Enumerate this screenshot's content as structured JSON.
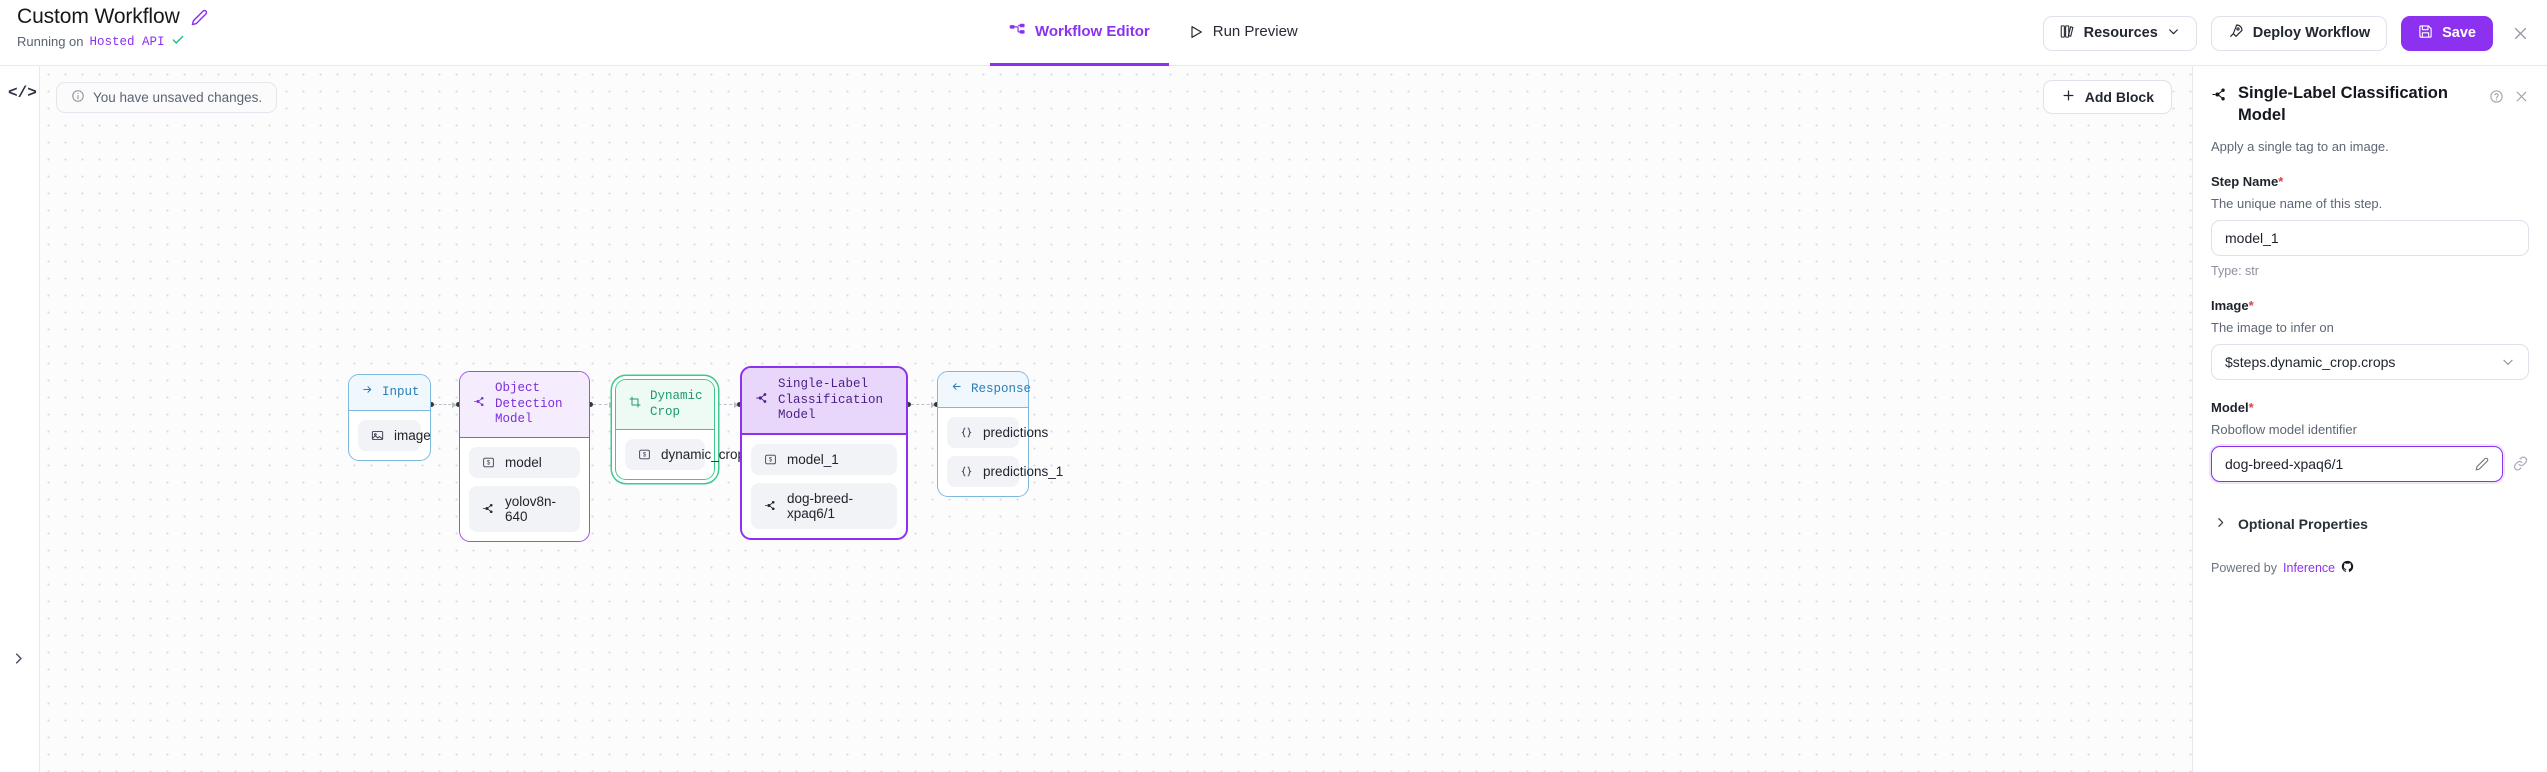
{
  "header": {
    "workflow_title": "Custom Workflow",
    "edit_icon": "pencil-icon",
    "running_prefix": "Running on",
    "running_target": "Hosted API",
    "running_status_icon": "check-icon",
    "tabs": [
      {
        "label": "Workflow Editor",
        "icon": "workflow-icon",
        "active": true
      },
      {
        "label": "Run Preview",
        "icon": "play-icon",
        "active": false
      }
    ],
    "actions": {
      "resources_label": "Resources",
      "resources_icon": "books-icon",
      "resources_caret": "chevron-down-icon",
      "deploy_label": "Deploy Workflow",
      "deploy_icon": "rocket-icon",
      "save_label": "Save",
      "save_icon": "floppy-disk-icon",
      "close_icon": "close-icon"
    }
  },
  "rail": {
    "code_icon": "code-icon",
    "expand_icon": "chevron-right-icon"
  },
  "canvas": {
    "unsaved_note": "You have unsaved changes.",
    "unsaved_icon": "info-icon",
    "add_block_label": "Add Block",
    "add_block_icon": "plus-icon",
    "nodes": [
      {
        "id": "input",
        "title": "Input",
        "title_icon": "arrow-right-icon",
        "chips": [
          {
            "label": "image",
            "icon": "image-icon"
          }
        ]
      },
      {
        "id": "object_detection",
        "title": "Object Detection Model",
        "title_icon": "model-icon",
        "chips": [
          {
            "label": "model",
            "icon": "variable-icon"
          },
          {
            "label": "yolov8n-640",
            "icon": "model-icon"
          }
        ]
      },
      {
        "id": "dynamic_crop",
        "title": "Dynamic Crop",
        "title_icon": "crop-icon",
        "chips": [
          {
            "label": "dynamic_crop",
            "icon": "variable-icon"
          }
        ]
      },
      {
        "id": "single_label",
        "title": "Single-Label Classification Model",
        "title_icon": "model-icon",
        "chips": [
          {
            "label": "model_1",
            "icon": "variable-icon"
          },
          {
            "label": "dog-breed-xpaq6/1",
            "icon": "model-icon"
          }
        ]
      },
      {
        "id": "response",
        "title": "Response",
        "title_icon": "arrow-left-icon",
        "chips": [
          {
            "label": "predictions",
            "icon": "braces-icon"
          },
          {
            "label": "predictions_1",
            "icon": "braces-icon"
          }
        ]
      }
    ]
  },
  "panel": {
    "title": "Single-Label Classification Model",
    "title_icon": "model-icon",
    "help_icon": "question-circle-icon",
    "close_icon": "close-icon",
    "description": "Apply a single tag to an image.",
    "fields": [
      {
        "label": "Step Name",
        "required": "*",
        "help": "The unique name of this step.",
        "value": "model_1",
        "type_note": "Type: str"
      },
      {
        "label": "Image",
        "required": "*",
        "help": "The image to infer on",
        "value": "$steps.dynamic_crop.crops",
        "caret_icon": "chevron-down-icon"
      },
      {
        "label": "Model",
        "required": "*",
        "help": "Roboflow model identifier",
        "value": "dog-breed-xpaq6/1",
        "edit_icon": "pencil-icon",
        "link_icon": "link-icon"
      }
    ],
    "optional_properties_label": "Optional Properties",
    "optional_properties_icon": "chevron-right-icon",
    "powered_prefix": "Powered by",
    "powered_link": "Inference",
    "powered_icon": "github-icon"
  },
  "colors": {
    "accent": "#8b31ef",
    "blue_node": "#7db8df",
    "green_node": "#3fc98c",
    "required_red": "#e0403f",
    "check_green": "#2dc08a"
  }
}
